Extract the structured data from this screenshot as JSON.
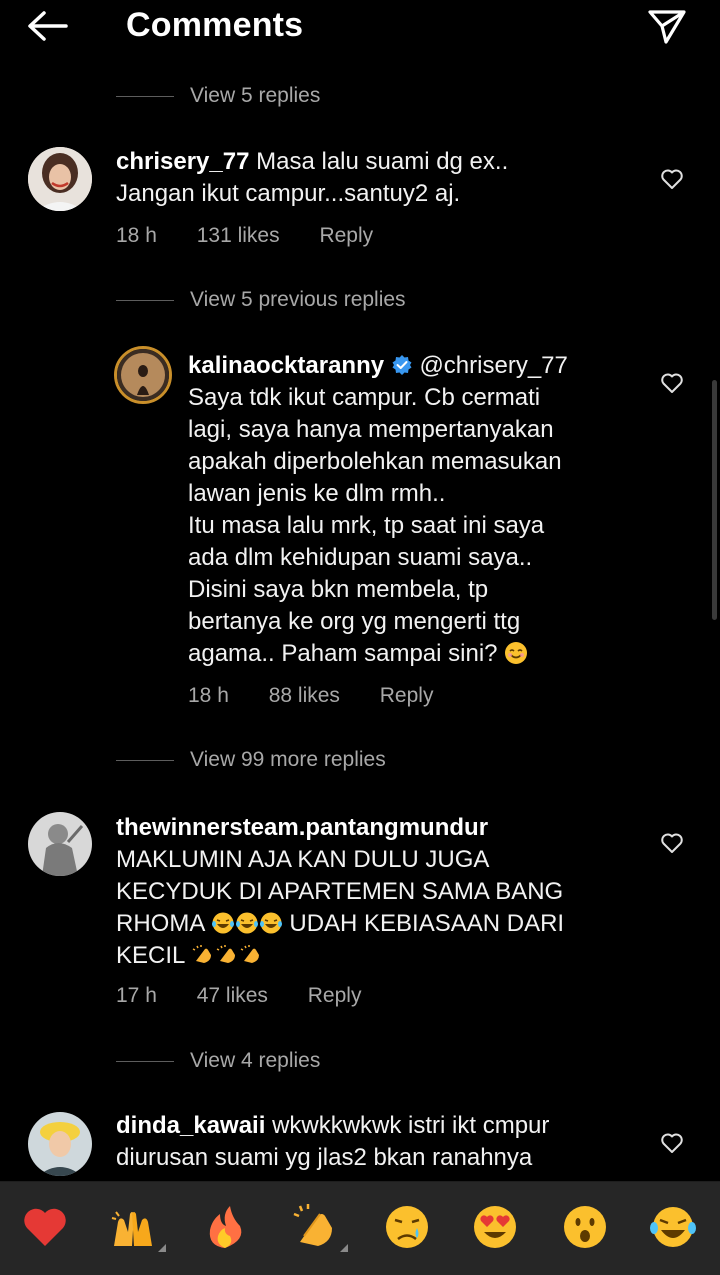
{
  "header": {
    "title": "Comments"
  },
  "threads": {
    "view1": "View 5 replies",
    "c1": {
      "username": "chrisery_77",
      "text1": "Masa lalu suami dg ex..",
      "text2": "Jangan ikut campur...santuy2 aj.",
      "time": "18 h",
      "likes": "131 likes",
      "reply": "Reply"
    },
    "view2": "View 5 previous replies",
    "c2": {
      "username": "kalinaocktaranny",
      "mention": "@chrisery_77",
      "lines": [
        "Saya tdk ikut campur. Cb cermati",
        "lagi, saya hanya mempertanyakan",
        "apakah diperbolehkan memasukan",
        "lawan jenis ke dlm rmh..",
        "Itu masa lalu mrk, tp saat ini saya",
        "ada dlm kehidupan suami saya..",
        "Disini saya bkn membela, tp",
        "bertanya ke org yg mengerti ttg",
        "agama.. Paham sampai sini?"
      ],
      "time": "18 h",
      "likes": "88 likes",
      "reply": "Reply"
    },
    "view3": "View 99 more replies",
    "c3": {
      "username": "thewinnersteam.pantangmundur",
      "line1": "MAKLUMIN AJA KAN DULU JUGA",
      "line2": "KECYDUK DI APARTEMEN SAMA BANG",
      "line3a": "RHOMA",
      "line3b": "UDAH KEBIASAAN DARI",
      "line4": "KECIL",
      "time": "17 h",
      "likes": "47 likes",
      "reply": "Reply"
    },
    "view4": "View 4 replies",
    "c4": {
      "username": "dinda_kawaii",
      "text1": "wkwkkwkwk istri ikt cmpur",
      "text2": "diurusan suami yg jlas2 bkan ranahnya"
    }
  },
  "emoji_bar": [
    "red-heart",
    "raising-hands",
    "fire",
    "clapping-hands",
    "crying-face",
    "heart-eyes",
    "surprised-face",
    "tears-of-joy"
  ],
  "colors": {
    "background": "#000000",
    "secondary_text": "#a8a8a8",
    "verified_blue": "#3897f0",
    "emoji_bar_bg": "#262626"
  }
}
